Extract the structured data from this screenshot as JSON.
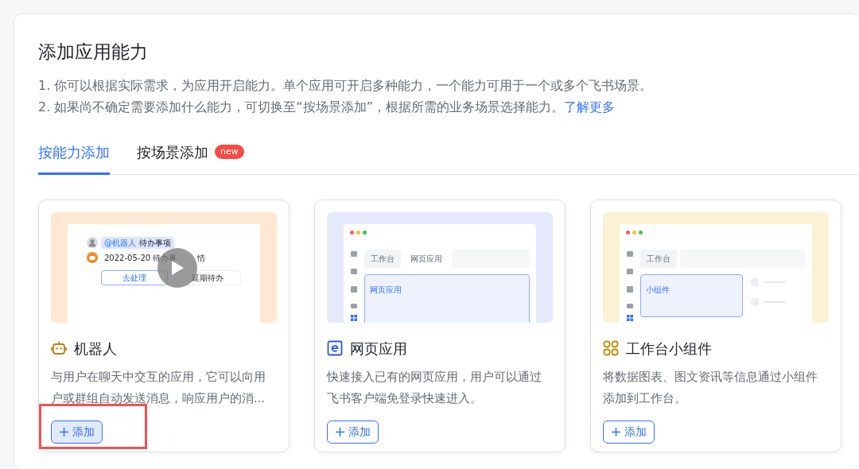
{
  "heading": "添加应用能力",
  "notes": [
    {
      "text": "1. 你可以根据实际需求，为应用开启能力。单个应用可开启多种能力，一个能力可用于一个或多个飞书场景。"
    },
    {
      "text": "2. 如果尚不确定需要添加什么能力，可切换至“按场景添加”，根据所需的业务场景选择能力。",
      "link": "了解更多"
    }
  ],
  "tabs": [
    {
      "label": "按能力添加",
      "selected": true
    },
    {
      "label": "按场景添加",
      "selected": false,
      "badge": "new"
    }
  ],
  "cards": [
    {
      "kind": "bot",
      "color": "#fde9d3",
      "title": "机器人",
      "description": "与用户在聊天中交互的应用，它可以向用户或群组自动发送消息，响应用户的消...",
      "button": "添加",
      "highlighted": true,
      "marked": true,
      "preview": {
        "mention": "@机器人",
        "topic": "待办事项",
        "message": [
          "2022-05-20 待办事",
          "情"
        ],
        "actions": [
          "去处理",
          "延期待办"
        ]
      }
    },
    {
      "kind": "web",
      "color": "#e4eafc",
      "title": "网页应用",
      "description": "快速接入已有的网页应用，用户可以通过飞书客户端免登录快速进入。",
      "button": "添加",
      "highlighted": false,
      "marked": false,
      "preview": {
        "tabs": [
          "工作台",
          "网页应用"
        ],
        "panel": "网页应用"
      }
    },
    {
      "kind": "widget",
      "color": "#fbf1d3",
      "title": "工作台小组件",
      "description": "将数据图表、图文资讯等信息通过小组件添加到工作台。",
      "button": "添加",
      "highlighted": false,
      "marked": false,
      "preview": {
        "tabs": [
          "工作台"
        ],
        "panel": "小组件"
      }
    }
  ]
}
